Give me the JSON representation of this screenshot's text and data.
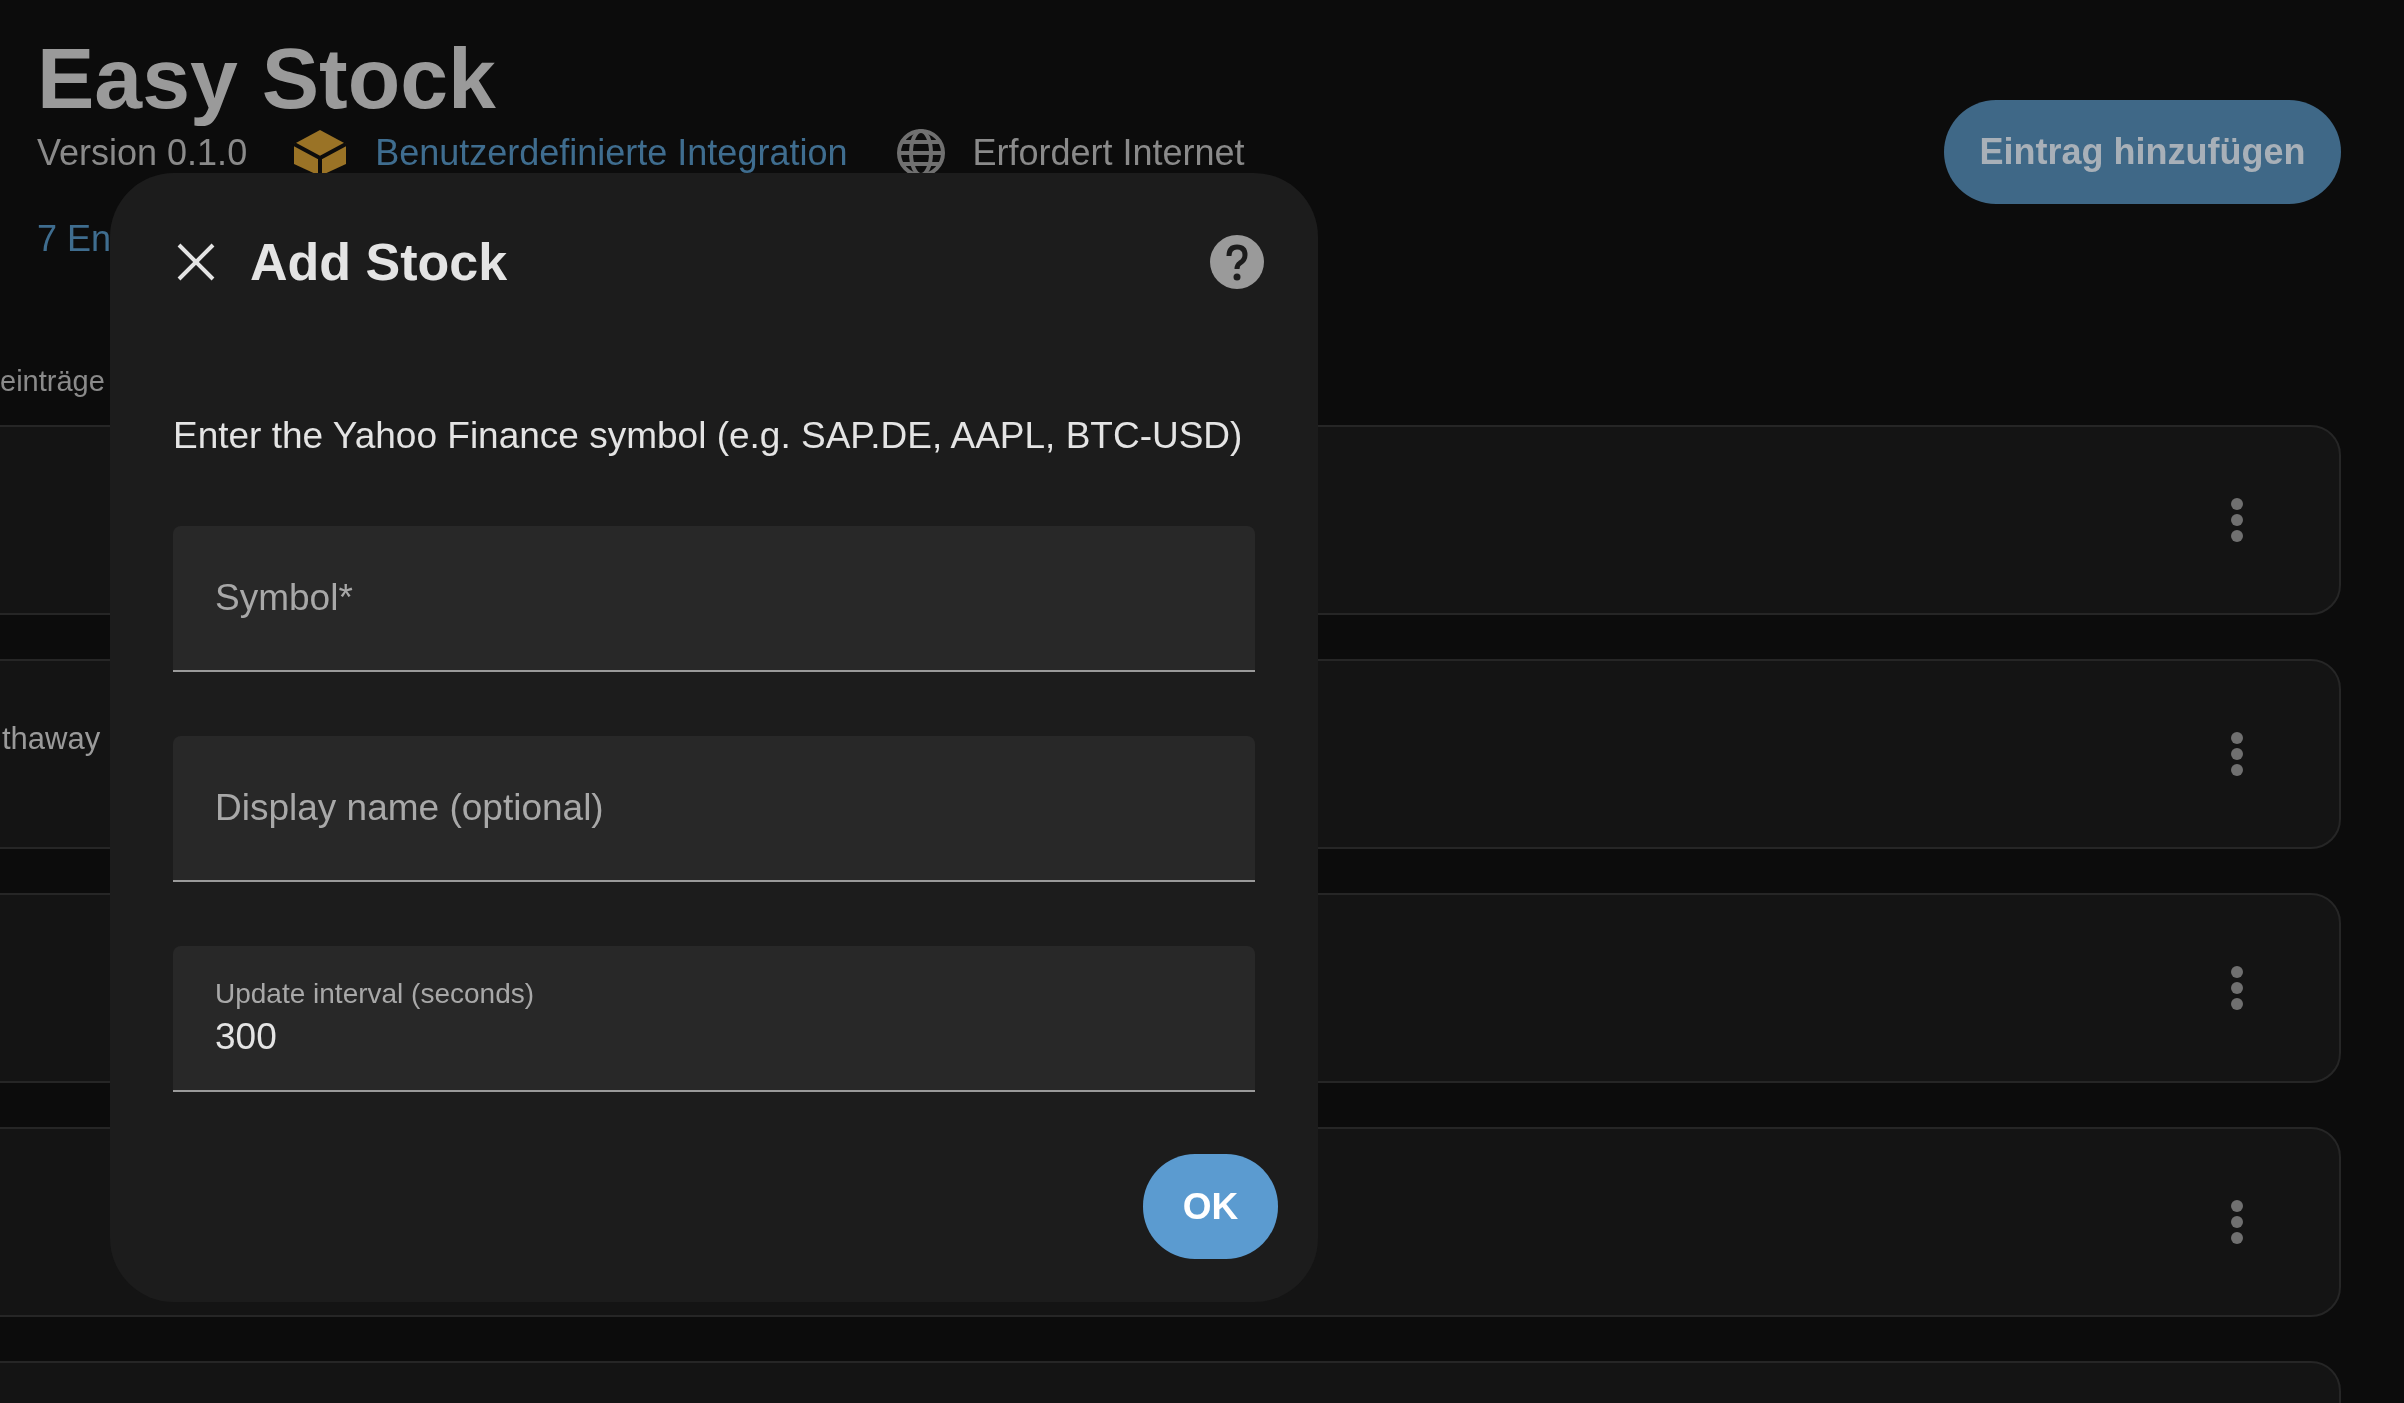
{
  "header": {
    "title": "Easy Stock",
    "version": "Version 0.1.0",
    "integration_link": "Benutzerdefinierte Integration",
    "requirement": "Erfordert Internet",
    "entries_link": "7 En"
  },
  "add_button": "Eintrag hinzufügen",
  "section_label": "einträge",
  "entries": [
    {
      "kind": "row"
    },
    {
      "kind": "row",
      "name": "thaway"
    },
    {
      "kind": "row"
    },
    {
      "kind": "row"
    },
    {
      "kind": "cut"
    }
  ],
  "dialog": {
    "title": "Add Stock",
    "description": "Enter the Yahoo Finance symbol (e.g. SAP.DE, AAPL, BTC-USD)",
    "fields": [
      {
        "label": "Symbol*"
      },
      {
        "label": "Display name (optional)"
      },
      {
        "label": "Update interval (seconds)",
        "value": "300"
      }
    ],
    "ok_button": "OK"
  }
}
